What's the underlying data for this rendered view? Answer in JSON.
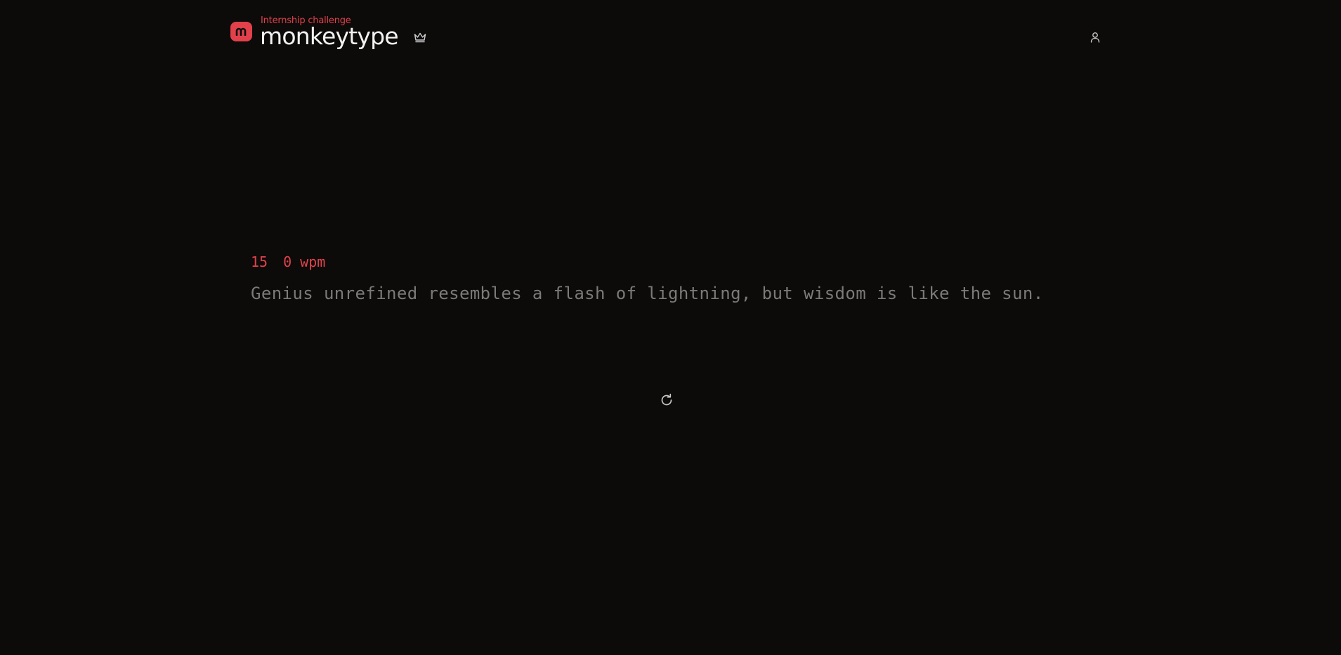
{
  "header": {
    "subtitle": "Internship challenge",
    "title": "monkeytype",
    "icons": {
      "logo": "monkeytype-logo-icon",
      "leaderboard": "crown-icon",
      "account": "user-icon"
    }
  },
  "test": {
    "time_remaining": "15",
    "wpm": "0 wpm",
    "text": "Genius unrefined resembles a flash of lightning, but wisdom is like the sun.",
    "restart_icon": "refresh-icon"
  },
  "colors": {
    "background": "#0c0b0a",
    "accent": "#e2414b",
    "title": "#f2f2f2",
    "untyped_text": "#7b7a78",
    "icon": "#c9c9c9"
  }
}
